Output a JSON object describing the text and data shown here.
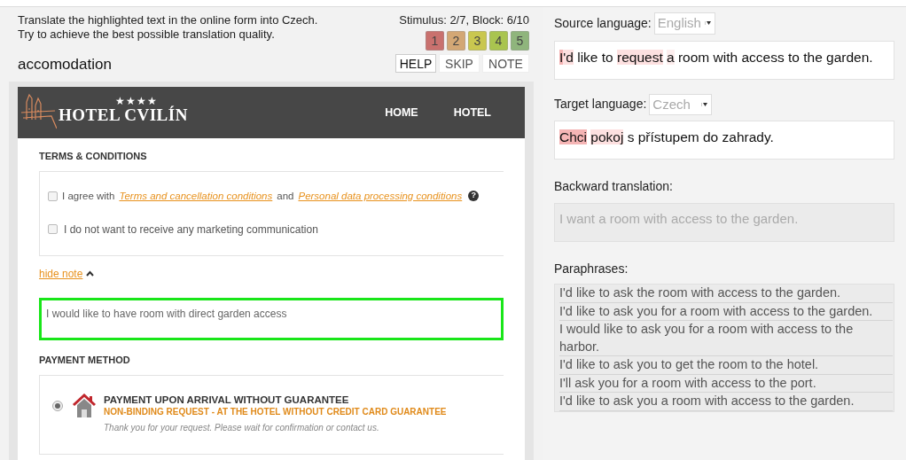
{
  "task": {
    "instructions": [
      "Translate the highlighted text in the online form into Czech.",
      "Try to achieve the best possible translation quality."
    ],
    "progress": "Stimulus: 2/7, Block: 6/10",
    "heading": "accomodation",
    "ratings": [
      {
        "label": "1",
        "color": "#c9716e"
      },
      {
        "label": "2",
        "color": "#d3a775"
      },
      {
        "label": "3",
        "color": "#c9c74f"
      },
      {
        "label": "4",
        "color": "#a9c44f"
      },
      {
        "label": "5",
        "color": "#8fb57c"
      }
    ],
    "buttons": [
      "HELP",
      "SKIP",
      "NOTE"
    ]
  },
  "hotel_form": {
    "logo": {
      "stars": "★★★★",
      "name": "HOTEL CVILÍN"
    },
    "nav": [
      "HOME",
      "HOTEL"
    ],
    "terms_title": "TERMS & CONDITIONS",
    "agree": {
      "checked": false,
      "prefix": "I agree with",
      "link1": "Terms and cancellation conditions",
      "middle": "and",
      "link2": "Personal data processing conditions",
      "help_glyph": "?"
    },
    "marketing": {
      "checked": false,
      "label": "I do not want to receive any marketing communication"
    },
    "hide_note": "hide note",
    "note_value": "I would like to have room with direct garden access",
    "payment_title": "PAYMENT METHOD",
    "payment": {
      "selected": true,
      "title": "PAYMENT UPON ARRIVAL WITHOUT GUARANTEE",
      "subtitle": "NON-BINDING REQUEST - AT THE HOTEL WITHOUT CREDIT CARD GUARANTEE",
      "note": "Thank you for your request. Please wait for confirmation or contact us."
    }
  },
  "translation": {
    "source_label": "Source language:",
    "source_language": "English",
    "source_text": [
      {
        "text": "I",
        "kind": "strong"
      },
      {
        "text": "'d",
        "kind": "light"
      },
      {
        "text": " like to ",
        "kind": "plain"
      },
      {
        "text": "request",
        "kind": "light"
      },
      {
        "text": " a",
        "kind": "faint"
      },
      {
        "text": " room with access to the garden.",
        "kind": "plain"
      }
    ],
    "target_label": "Target language:",
    "target_language": "Czech",
    "target_text": [
      {
        "text": "Chci",
        "kind": "strong"
      },
      {
        "text": " pokoj",
        "kind": "light"
      },
      {
        "text": " s přístupem do zahrady.",
        "kind": "plain"
      }
    ],
    "backward_label": "Backward translation:",
    "backward_text": "I want a room with access to the garden.",
    "paraphrases_label": "Paraphrases:",
    "paraphrases": [
      "I'd like to ask the room with access to the garden.",
      "I'd like to ask you for a room with access to the garden.",
      "I would like to ask you for a room with access to the harbor.",
      "I'd like to ask you to get the room to the hotel.",
      "I'll ask you for a room with access to the port.",
      "I'd like to ask you a room with access to the garden."
    ]
  }
}
